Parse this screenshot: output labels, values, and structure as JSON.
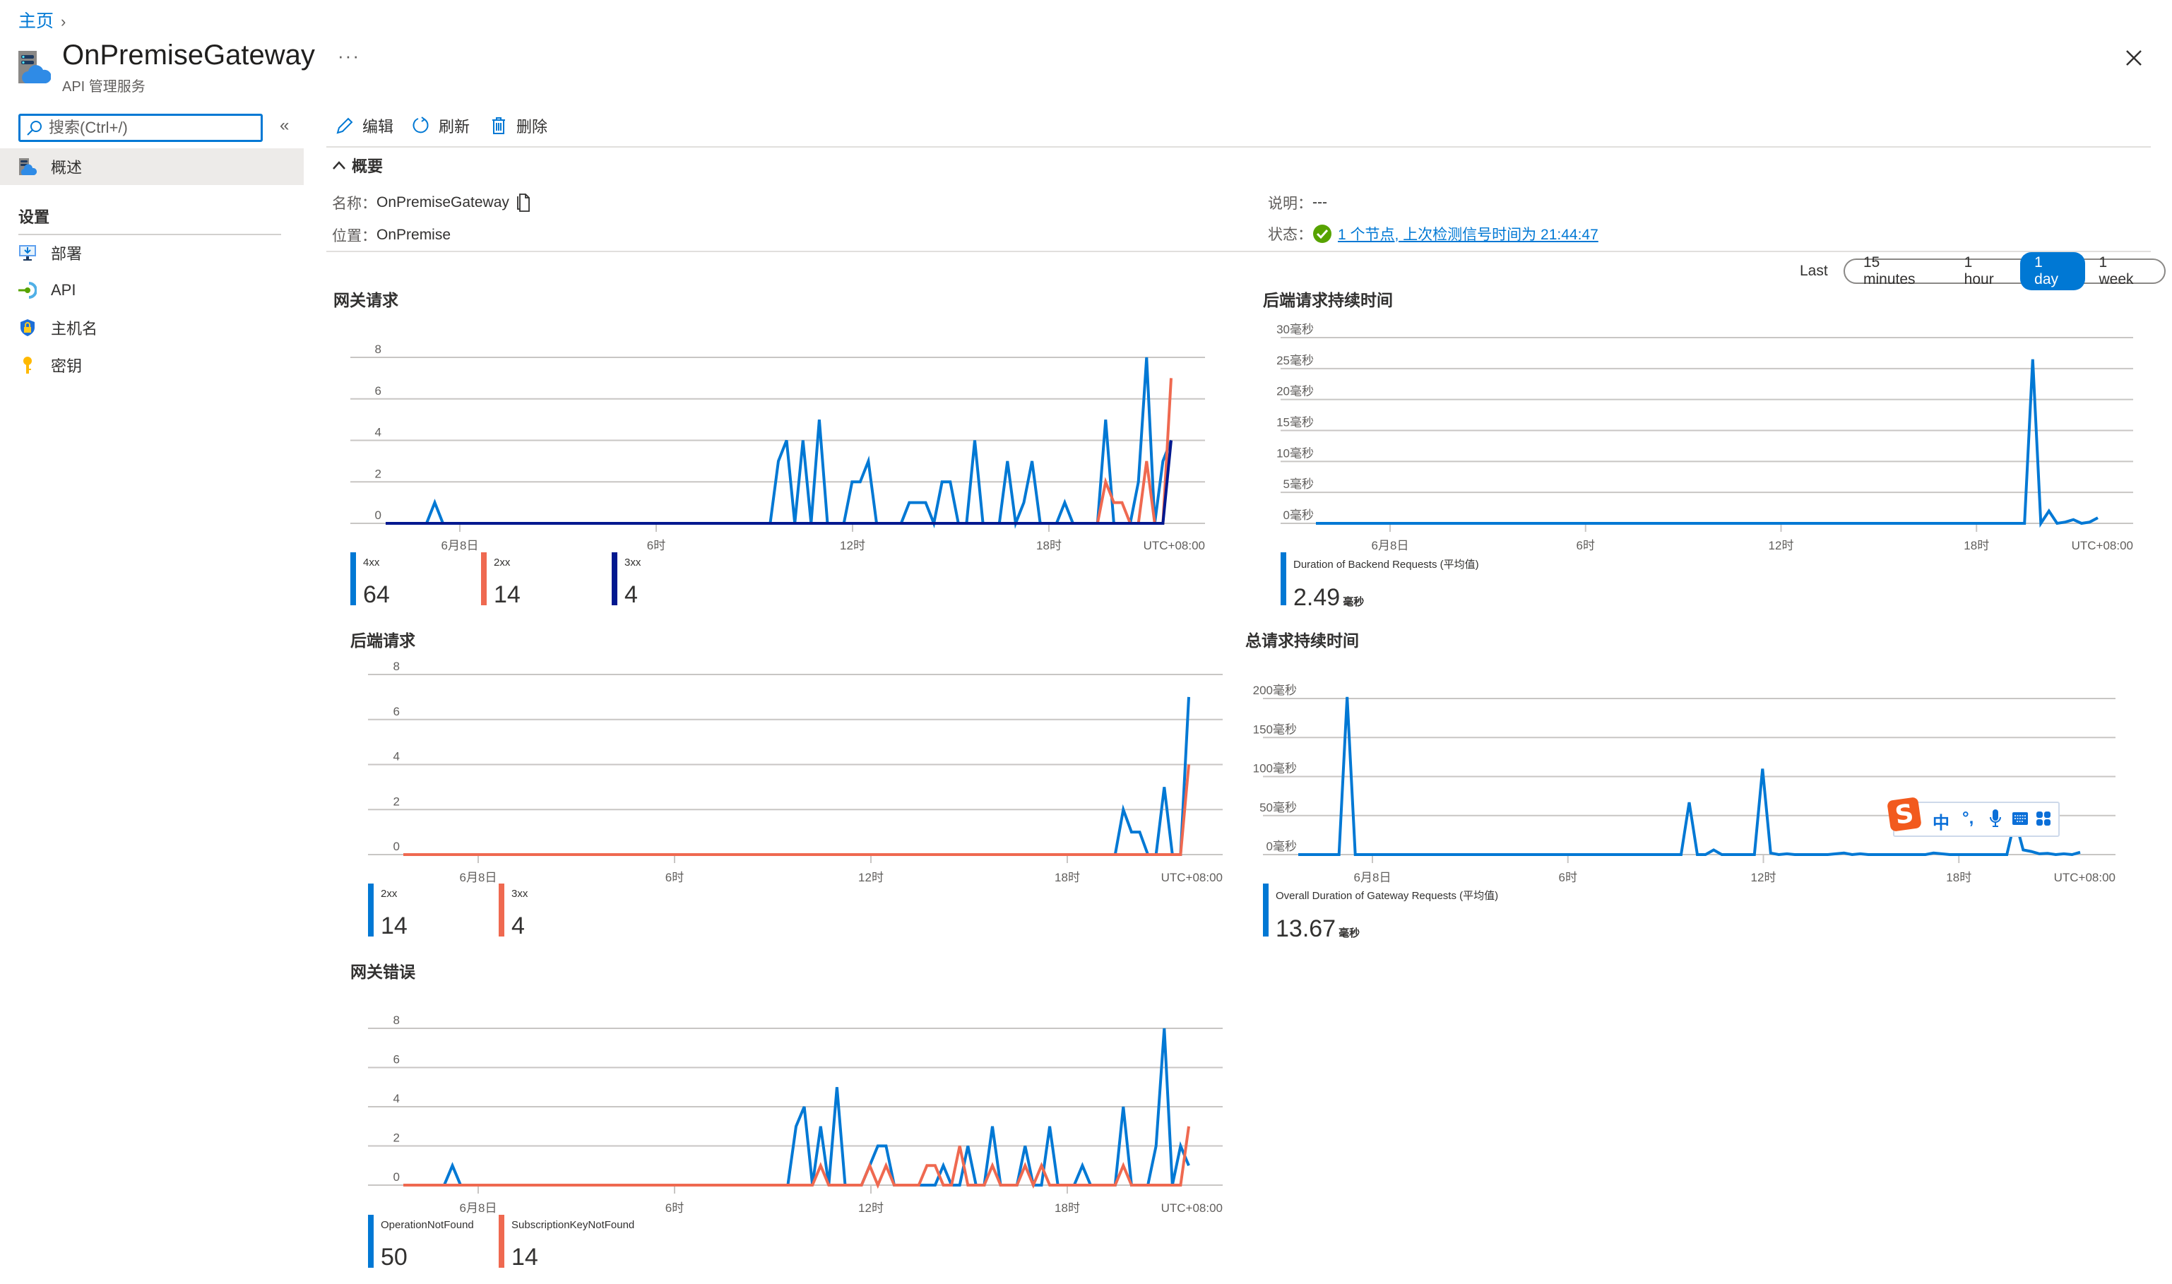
{
  "breadcrumb": {
    "home": "主页",
    "separator": "›"
  },
  "header": {
    "title": "OnPremiseGateway",
    "subtitle": "API 管理服务",
    "more": "···",
    "close_icon": "close-icon"
  },
  "sidebar": {
    "search_placeholder": "搜索(Ctrl+/)",
    "collapse": "«",
    "overview": "概述",
    "settings_header": "设置",
    "items": [
      {
        "label": "部署",
        "icon": "deployment-icon"
      },
      {
        "label": "API",
        "icon": "api-icon"
      },
      {
        "label": "主机名",
        "icon": "hostname-shield-icon"
      },
      {
        "label": "密钥",
        "icon": "key-icon"
      }
    ]
  },
  "toolbar": {
    "edit": "编辑",
    "refresh": "刷新",
    "delete": "删除"
  },
  "essentials": {
    "header": "概要",
    "name_label": "名称",
    "name_value": "OnPremiseGateway",
    "location_label": "位置",
    "location_value": "OnPremise",
    "description_label": "说明",
    "description_value": "---",
    "status_label": "状态",
    "status_value": "1 个节点, 上次检测信号时间为 21:44:47",
    "colon": "："
  },
  "time_range": {
    "label": "Last",
    "options": [
      "15 minutes",
      "1 hour",
      "1 day",
      "1 week"
    ],
    "selected": "1 day"
  },
  "colors": {
    "blue": "#0078d4",
    "red": "#ef6950",
    "navy": "#00188f",
    "grid": "#c8c6c4",
    "accent": "#0078d4"
  },
  "ime": {
    "mode": "中",
    "punct": "°,"
  },
  "chart_data": [
    {
      "id": "gateway-requests",
      "type": "line",
      "title": "网关请求",
      "x_ticks": [
        "6月8日",
        "6时",
        "12时",
        "18时",
        "UTC+08:00"
      ],
      "x_note": "15-minute buckets over last 1 day, index 9 = 6月8日 00:00",
      "ylim": [
        0,
        8
      ],
      "y_ticks": [
        "0",
        "2",
        "4",
        "6",
        "8"
      ],
      "grid": true,
      "series": [
        {
          "name": "4xx",
          "color": "#0078d4",
          "total": "64",
          "points": {
            "6": 1,
            "48": 3,
            "49": 4,
            "51": 4,
            "53": 5,
            "57": 2,
            "58": 2,
            "59": 3,
            "64": 1,
            "65": 1,
            "66": 1,
            "68": 2,
            "69": 2,
            "72": 4,
            "76": 3,
            "78": 1,
            "79": 3,
            "83": 1,
            "88": 5,
            "92": 2,
            "93": 8,
            "95": 3,
            "96": 4
          }
        },
        {
          "name": "2xx",
          "color": "#ef6950",
          "total": "14",
          "points": {
            "88": 2,
            "89": 1,
            "90": 1,
            "93": 3,
            "96": 7
          }
        },
        {
          "name": "3xx",
          "color": "#00188f",
          "total": "4",
          "points": {
            "96": 4
          }
        }
      ]
    },
    {
      "id": "backend-duration",
      "type": "line",
      "title": "后端请求持续时间",
      "x_ticks": [
        "6月8日",
        "6时",
        "12时",
        "18时",
        "UTC+08:00"
      ],
      "ylim": [
        0,
        30
      ],
      "y_ticks": [
        "0毫秒",
        "5毫秒",
        "10毫秒",
        "15毫秒",
        "20毫秒",
        "25毫秒",
        "30毫秒"
      ],
      "grid": true,
      "series": [
        {
          "name": "Duration of Backend Requests (平均值)",
          "color": "#0078d4",
          "total": "2.49",
          "unit": "毫秒",
          "points": {
            "88": 26.5,
            "90": 2,
            "92": 0.2,
            "93": 0.6,
            "95": 0.2,
            "96": 0.9
          }
        }
      ]
    },
    {
      "id": "backend-requests",
      "type": "line",
      "title": "后端请求",
      "x_ticks": [
        "6月8日",
        "6时",
        "12时",
        "18时",
        "UTC+08:00"
      ],
      "ylim": [
        0,
        8
      ],
      "y_ticks": [
        "0",
        "2",
        "4",
        "6",
        "8"
      ],
      "grid": true,
      "series": [
        {
          "name": "2xx",
          "color": "#0078d4",
          "total": "14",
          "points": {
            "88": 2,
            "89": 1,
            "90": 1,
            "93": 3,
            "96": 7
          }
        },
        {
          "name": "3xx",
          "color": "#ef6950",
          "total": "4",
          "points": {
            "96": 4
          }
        }
      ]
    },
    {
      "id": "overall-duration",
      "type": "line",
      "title": "总请求持续时间",
      "x_ticks": [
        "6月8日",
        "6时",
        "12时",
        "18时",
        "UTC+08:00"
      ],
      "ylim": [
        0,
        200
      ],
      "y_ticks": [
        "0毫秒",
        "50毫秒",
        "100毫秒",
        "150毫秒",
        "200毫秒"
      ],
      "grid": true,
      "series": [
        {
          "name": "Overall Duration of Gateway Requests (平均值)",
          "color": "#0078d4",
          "total": "13.67",
          "unit": "毫秒",
          "points": {
            "6": 202,
            "48": 67,
            "51": 6,
            "57": 110,
            "58": 2,
            "60": 1,
            "66": 1,
            "67": 2,
            "69": 1,
            "78": 2,
            "79": 1,
            "88": 45,
            "89": 6,
            "90": 4,
            "91": 1,
            "92": 1.5,
            "94": 1,
            "96": 3
          }
        }
      ]
    },
    {
      "id": "gateway-errors",
      "type": "line",
      "title": "网关错误",
      "x_ticks": [
        "6月8日",
        "6时",
        "12时",
        "18时",
        "UTC+08:00"
      ],
      "ylim": [
        0,
        8
      ],
      "y_ticks": [
        "0",
        "2",
        "4",
        "6",
        "8"
      ],
      "grid": true,
      "series": [
        {
          "name": "OperationNotFound",
          "color": "#0078d4",
          "total": "50",
          "points": {
            "6": 1,
            "48": 3,
            "49": 4,
            "51": 3,
            "53": 5,
            "57": 1,
            "58": 2,
            "59": 2,
            "66": 1,
            "69": 2,
            "72": 3,
            "76": 2,
            "79": 3,
            "83": 1,
            "88": 4,
            "92": 2,
            "93": 8,
            "95": 2,
            "96": 1
          }
        },
        {
          "name": "SubscriptionKeyNotFound",
          "color": "#ef6950",
          "total": "14",
          "points": {
            "51": 1,
            "57": 1,
            "59": 1,
            "64": 1,
            "65": 1,
            "68": 2,
            "72": 1,
            "76": 1,
            "78": 1,
            "88": 1,
            "96": 3
          }
        }
      ]
    }
  ]
}
